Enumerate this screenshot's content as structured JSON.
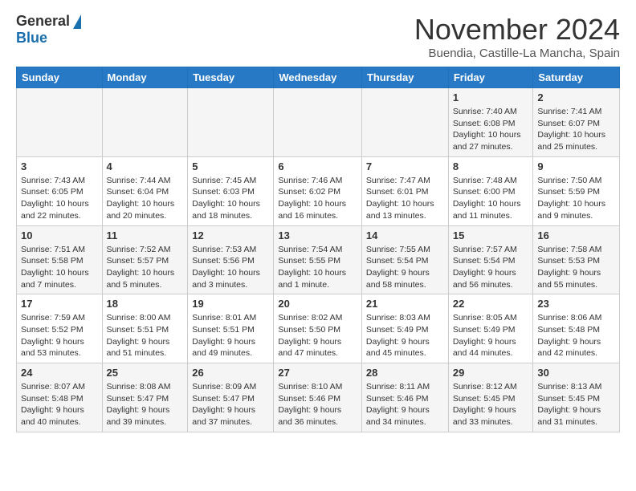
{
  "header": {
    "logo_general": "General",
    "logo_blue": "Blue",
    "month": "November 2024",
    "location": "Buendia, Castille-La Mancha, Spain"
  },
  "weekdays": [
    "Sunday",
    "Monday",
    "Tuesday",
    "Wednesday",
    "Thursday",
    "Friday",
    "Saturday"
  ],
  "weeks": [
    [
      {
        "day": "",
        "info": ""
      },
      {
        "day": "",
        "info": ""
      },
      {
        "day": "",
        "info": ""
      },
      {
        "day": "",
        "info": ""
      },
      {
        "day": "",
        "info": ""
      },
      {
        "day": "1",
        "info": "Sunrise: 7:40 AM\nSunset: 6:08 PM\nDaylight: 10 hours and 27 minutes."
      },
      {
        "day": "2",
        "info": "Sunrise: 7:41 AM\nSunset: 6:07 PM\nDaylight: 10 hours and 25 minutes."
      }
    ],
    [
      {
        "day": "3",
        "info": "Sunrise: 7:43 AM\nSunset: 6:05 PM\nDaylight: 10 hours and 22 minutes."
      },
      {
        "day": "4",
        "info": "Sunrise: 7:44 AM\nSunset: 6:04 PM\nDaylight: 10 hours and 20 minutes."
      },
      {
        "day": "5",
        "info": "Sunrise: 7:45 AM\nSunset: 6:03 PM\nDaylight: 10 hours and 18 minutes."
      },
      {
        "day": "6",
        "info": "Sunrise: 7:46 AM\nSunset: 6:02 PM\nDaylight: 10 hours and 16 minutes."
      },
      {
        "day": "7",
        "info": "Sunrise: 7:47 AM\nSunset: 6:01 PM\nDaylight: 10 hours and 13 minutes."
      },
      {
        "day": "8",
        "info": "Sunrise: 7:48 AM\nSunset: 6:00 PM\nDaylight: 10 hours and 11 minutes."
      },
      {
        "day": "9",
        "info": "Sunrise: 7:50 AM\nSunset: 5:59 PM\nDaylight: 10 hours and 9 minutes."
      }
    ],
    [
      {
        "day": "10",
        "info": "Sunrise: 7:51 AM\nSunset: 5:58 PM\nDaylight: 10 hours and 7 minutes."
      },
      {
        "day": "11",
        "info": "Sunrise: 7:52 AM\nSunset: 5:57 PM\nDaylight: 10 hours and 5 minutes."
      },
      {
        "day": "12",
        "info": "Sunrise: 7:53 AM\nSunset: 5:56 PM\nDaylight: 10 hours and 3 minutes."
      },
      {
        "day": "13",
        "info": "Sunrise: 7:54 AM\nSunset: 5:55 PM\nDaylight: 10 hours and 1 minute."
      },
      {
        "day": "14",
        "info": "Sunrise: 7:55 AM\nSunset: 5:54 PM\nDaylight: 9 hours and 58 minutes."
      },
      {
        "day": "15",
        "info": "Sunrise: 7:57 AM\nSunset: 5:54 PM\nDaylight: 9 hours and 56 minutes."
      },
      {
        "day": "16",
        "info": "Sunrise: 7:58 AM\nSunset: 5:53 PM\nDaylight: 9 hours and 55 minutes."
      }
    ],
    [
      {
        "day": "17",
        "info": "Sunrise: 7:59 AM\nSunset: 5:52 PM\nDaylight: 9 hours and 53 minutes."
      },
      {
        "day": "18",
        "info": "Sunrise: 8:00 AM\nSunset: 5:51 PM\nDaylight: 9 hours and 51 minutes."
      },
      {
        "day": "19",
        "info": "Sunrise: 8:01 AM\nSunset: 5:51 PM\nDaylight: 9 hours and 49 minutes."
      },
      {
        "day": "20",
        "info": "Sunrise: 8:02 AM\nSunset: 5:50 PM\nDaylight: 9 hours and 47 minutes."
      },
      {
        "day": "21",
        "info": "Sunrise: 8:03 AM\nSunset: 5:49 PM\nDaylight: 9 hours and 45 minutes."
      },
      {
        "day": "22",
        "info": "Sunrise: 8:05 AM\nSunset: 5:49 PM\nDaylight: 9 hours and 44 minutes."
      },
      {
        "day": "23",
        "info": "Sunrise: 8:06 AM\nSunset: 5:48 PM\nDaylight: 9 hours and 42 minutes."
      }
    ],
    [
      {
        "day": "24",
        "info": "Sunrise: 8:07 AM\nSunset: 5:48 PM\nDaylight: 9 hours and 40 minutes."
      },
      {
        "day": "25",
        "info": "Sunrise: 8:08 AM\nSunset: 5:47 PM\nDaylight: 9 hours and 39 minutes."
      },
      {
        "day": "26",
        "info": "Sunrise: 8:09 AM\nSunset: 5:47 PM\nDaylight: 9 hours and 37 minutes."
      },
      {
        "day": "27",
        "info": "Sunrise: 8:10 AM\nSunset: 5:46 PM\nDaylight: 9 hours and 36 minutes."
      },
      {
        "day": "28",
        "info": "Sunrise: 8:11 AM\nSunset: 5:46 PM\nDaylight: 9 hours and 34 minutes."
      },
      {
        "day": "29",
        "info": "Sunrise: 8:12 AM\nSunset: 5:45 PM\nDaylight: 9 hours and 33 minutes."
      },
      {
        "day": "30",
        "info": "Sunrise: 8:13 AM\nSunset: 5:45 PM\nDaylight: 9 hours and 31 minutes."
      }
    ]
  ]
}
